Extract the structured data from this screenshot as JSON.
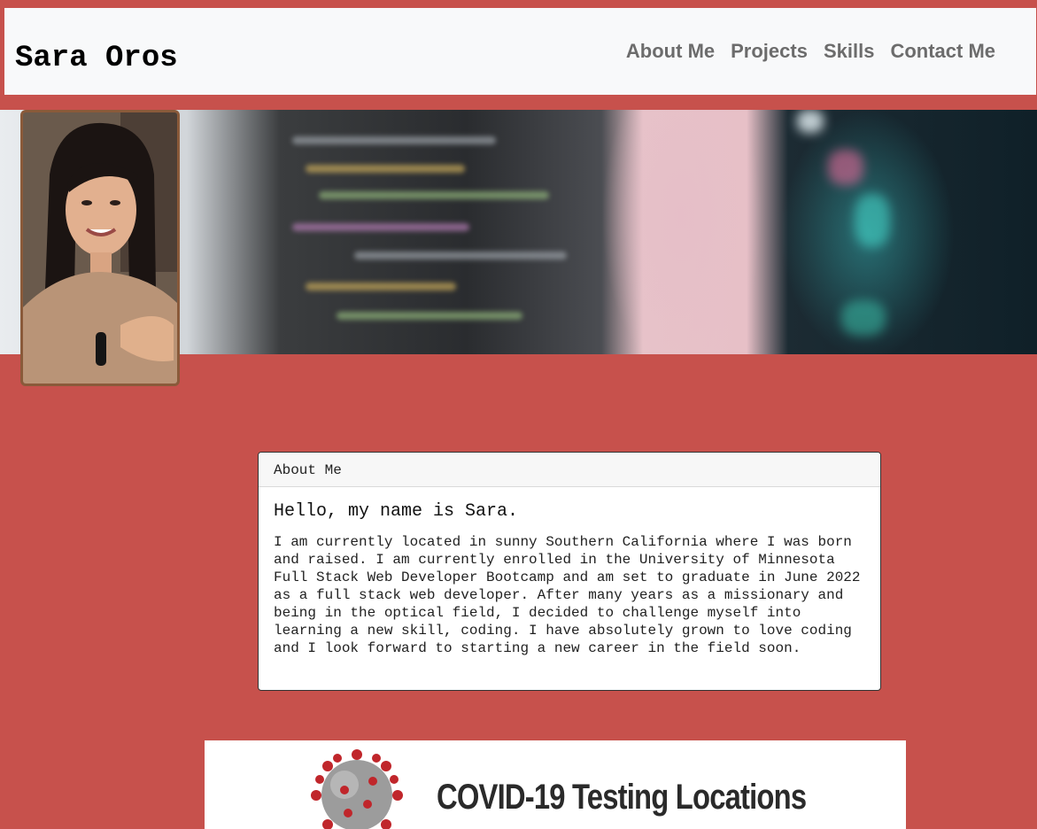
{
  "navbar": {
    "brand": "Sara Oros",
    "links": [
      "About Me",
      "Projects",
      "Skills",
      "Contact Me"
    ]
  },
  "hero": {
    "image": "blurred-code-monitor-photo",
    "avatar": "profile-photo-sara"
  },
  "about": {
    "header": "About Me",
    "title": "Hello, my name is Sara.",
    "text": "I am currently located in sunny Southern California where I was born and raised. I am currently enrolled in the University of Minnesota Full Stack Web Developer Bootcamp and am set to graduate in June 2022 as a full stack web developer. After many years as a missionary and being in the optical field, I decided to challenge myself into learning a new skill, coding. I have absolutely grown to love coding and I look forward to starting a new career in the field soon."
  },
  "project": {
    "title": "COVID-19 Testing Locations",
    "icon": "coronavirus-icon"
  },
  "colors": {
    "background": "#c7514c",
    "navbar": "#f8f9fa",
    "nav_link": "#6c6c6c"
  }
}
